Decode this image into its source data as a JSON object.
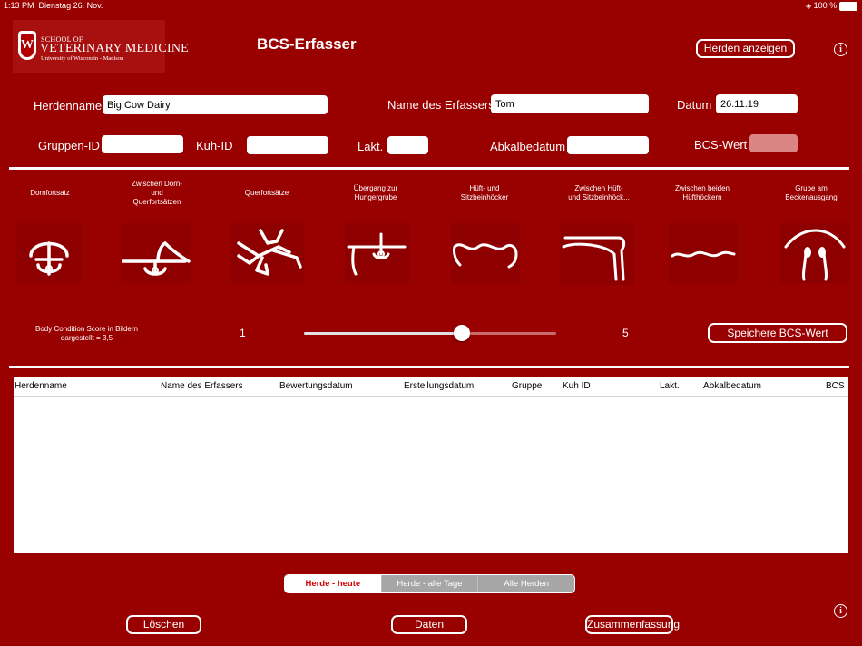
{
  "status_bar": {
    "time": "1:13 PM",
    "date": "Dienstag 26. Nov.",
    "battery": "100 %"
  },
  "logo": {
    "line1": "SCHOOL OF",
    "line2": "VETERINARY MEDICINE",
    "line3": "University of Wisconsin - Madison",
    "mark": "W"
  },
  "header": {
    "title": "BCS-Erfasser",
    "herds_button": "Herden anzeigen"
  },
  "form": {
    "herd_label": "Herdenname",
    "herd_value": "Big Cow Dairy",
    "recorder_label": "Name des Erfassers",
    "recorder_value": "Tom",
    "date_label": "Datum",
    "date_value": "26.11.19",
    "group_label": "Gruppen-ID",
    "group_value": "",
    "cow_label": "Kuh-ID",
    "cow_value": "",
    "lact_label": "Lakt.",
    "lact_value": "",
    "calving_label": "Abkalbedatum",
    "calving_value": "",
    "bcs_label": "BCS-Wert",
    "bcs_value": ""
  },
  "regions": [
    {
      "label": "Dornfortsatz",
      "icon": "spinous-process-icon"
    },
    {
      "label": "Zwischen Dorn-\nund\nQuerfortsätzen",
      "icon": "spinous-transverse-icon"
    },
    {
      "label": "Querfortsätze",
      "icon": "transverse-process-icon"
    },
    {
      "label": "Übergang zur\nHungergrube",
      "icon": "hunger-groove-icon"
    },
    {
      "label": "Hüft- und\nSitzbeinhöcker",
      "icon": "hip-pin-bones-icon"
    },
    {
      "label": "Zwischen Hüft-\nund Sitzbeinhöck...",
      "icon": "between-hip-pin-icon"
    },
    {
      "label": "Zwischen beiden\nHüfthöckern",
      "icon": "between-hooks-icon"
    },
    {
      "label": "Grube am\nBeckenausgang",
      "icon": "tailhead-pit-icon"
    }
  ],
  "score": {
    "caption": "Body Condition Score in Bildern\ndargestellt = 3,5",
    "min_label": "1",
    "max_label": "5",
    "min": 1,
    "max": 5,
    "value": 3.5,
    "save_button": "Speichere BCS-Wert"
  },
  "table": {
    "columns": [
      "Herdenname",
      "Name des Erfassers",
      "Bewertungsdatum",
      "Erstellungsdatum",
      "Gruppe",
      "Kuh ID",
      "Lakt.",
      "Abkalbedatum",
      "BCS"
    ],
    "rows": []
  },
  "segments": {
    "items": [
      "Herde - heute",
      "Herde - alle Tage",
      "Alle Herden"
    ],
    "selected": 0
  },
  "footer": {
    "delete_button": "Löschen",
    "data_button": "Daten",
    "summary_button": "Zusammenfassung"
  },
  "colors": {
    "background": "#990000",
    "accent": "#d40000",
    "text": "#ffffff"
  }
}
